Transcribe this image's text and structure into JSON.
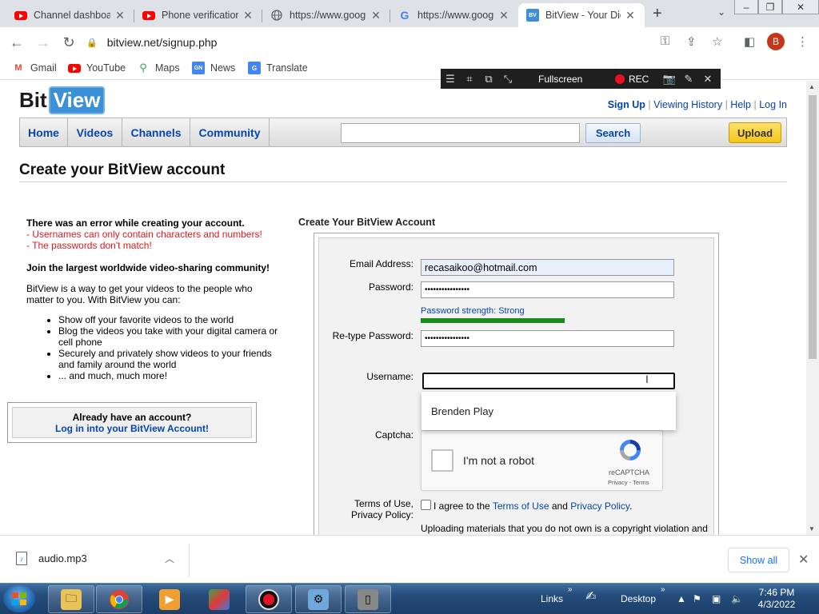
{
  "browser": {
    "tabs": [
      {
        "title": "Channel dashboard",
        "favicon": "youtube-icon",
        "active": false
      },
      {
        "title": "Phone verification",
        "favicon": "youtube-icon",
        "active": false
      },
      {
        "title": "https://www.google.com",
        "favicon": "globe-icon",
        "active": false
      },
      {
        "title": "https://www.google.com",
        "favicon": "google-icon",
        "active": false
      },
      {
        "title": "BitView - Your Digital Video Repository",
        "favicon": "bitview-icon",
        "active": true
      }
    ],
    "url": "bitview.net/signup.php",
    "profile_initial": "B",
    "bookmarks": [
      {
        "label": "Gmail",
        "icon": "gmail-icon"
      },
      {
        "label": "YouTube",
        "icon": "youtube-icon"
      },
      {
        "label": "Maps",
        "icon": "maps-icon"
      },
      {
        "label": "News",
        "icon": "news-icon"
      },
      {
        "label": "Translate",
        "icon": "translate-icon"
      }
    ]
  },
  "recorder": {
    "fullscreen_label": "Fullscreen",
    "rec_label": "REC"
  },
  "site": {
    "logo_bit": "Bit",
    "logo_view": "View",
    "top_links": [
      "Sign Up",
      "Viewing History",
      "Help",
      "Log In"
    ],
    "nav": [
      "Home",
      "Videos",
      "Channels",
      "Community"
    ],
    "search_value": "",
    "search_label": "Search",
    "upload_label": "Upload"
  },
  "page": {
    "title": "Create your BitView account",
    "error_heading": "There was an error while creating your account.",
    "errors": [
      "- Usernames can only contain characters and numbers!",
      "- The passwords don't match!"
    ],
    "join_heading": "Join the largest worldwide video-sharing community!",
    "intro": "BitView is a way to get your videos to the people who matter to you. With BitView you can:",
    "benefits": [
      "Show off your favorite videos to the world",
      "Blog the videos you take with your digital camera or cell phone",
      "Securely and privately show videos to your friends and family around the world",
      "... and much, much more!"
    ],
    "login_box": {
      "heading": "Already have an account?",
      "link": "Log in into your BitView Account!"
    }
  },
  "form": {
    "title": "Create Your BitView Account",
    "email_label": "Email Address:",
    "email_value": "recasaikoo@hotmail.com",
    "password_label": "Password:",
    "password_value": "••••••••••••••••",
    "password_strength": "Password strength: Strong",
    "password_strength_fraction": 0.57,
    "retype_label": "Re-type Password:",
    "retype_value": "••••••••••••••••",
    "username_label": "Username:",
    "username_value": "",
    "autocomplete_suggestion": "Brenden Play",
    "captcha_label": "Captcha:",
    "captcha_text": "I'm not a robot",
    "captcha_brand": "reCAPTCHA",
    "captcha_terms": "Privacy - Terms",
    "terms_label_1": "Terms of Use,",
    "terms_label_2": "Privacy Policy:",
    "agree_prefix": "I agree to the",
    "terms_link": "Terms of Use",
    "and": "and",
    "privacy_link": "Privacy Policy",
    "period": ".",
    "disclaimer": "Uploading materials that you do not own is a copyright violation and"
  },
  "downloads": {
    "file": "audio.mp3",
    "show_all": "Show all"
  },
  "taskbar": {
    "links_label": "Links",
    "desktop_label": "Desktop",
    "time": "7:46 PM",
    "date": "4/3/2022"
  },
  "colors": {
    "accent_link": "#0645ad",
    "error_red": "#e0191b",
    "strength_green": "#1a8a1a",
    "upload_yellow": "#f5c518"
  }
}
